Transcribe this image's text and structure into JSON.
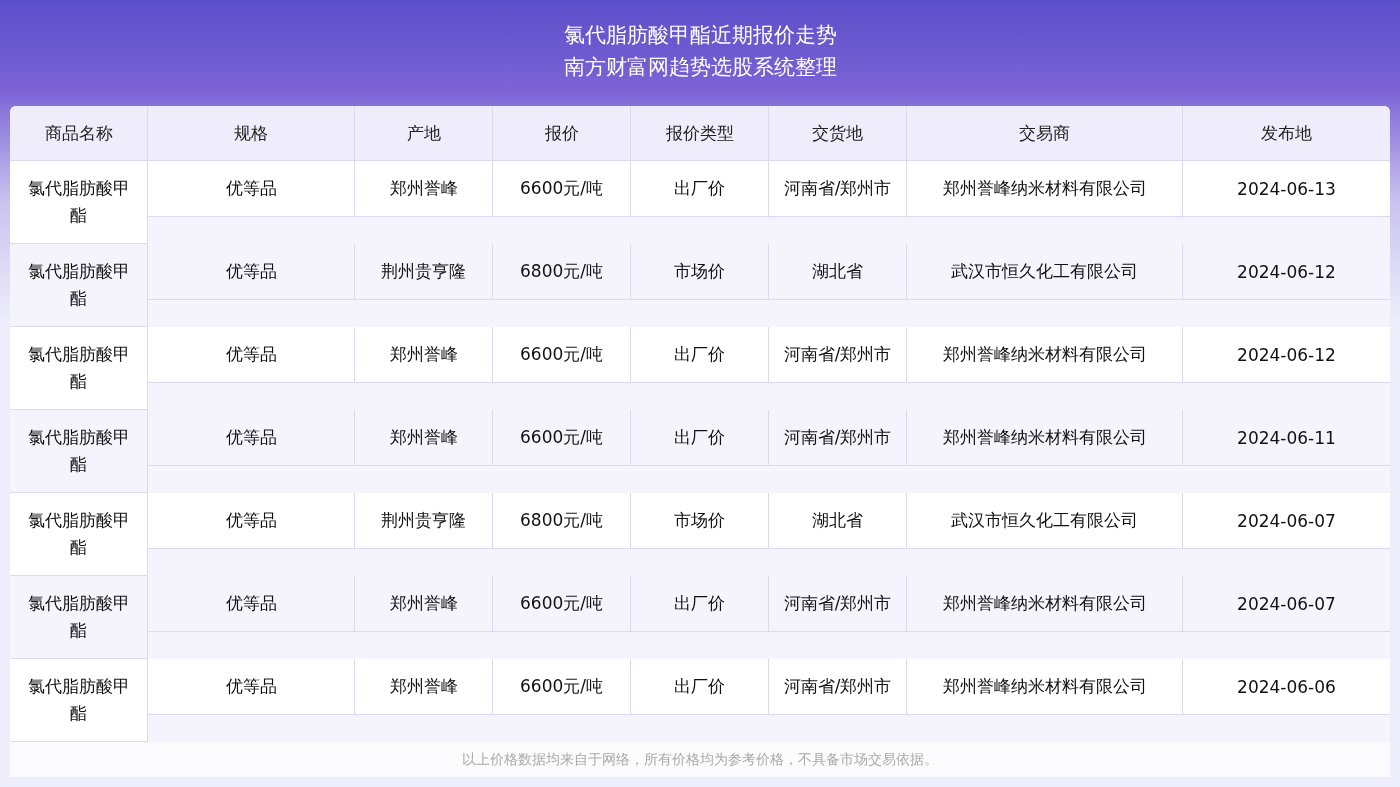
{
  "header": {
    "title": "氯代脂肪酸甲酯近期报价走势",
    "subtitle": "南方财富网趋势选股系统整理"
  },
  "table": {
    "columns": [
      "商品名称",
      "规格",
      "产地",
      "报价",
      "报价类型",
      "交货地",
      "交易商",
      "发布地"
    ],
    "rows": [
      [
        "氯代脂肪酸甲酯",
        "优等品",
        "郑州誉峰",
        "6600元/吨",
        "出厂价",
        "河南省/郑州市",
        "郑州誉峰纳米材料有限公司",
        "2024-06-13"
      ],
      [
        "氯代脂肪酸甲酯",
        "优等品",
        "荆州贵亨隆",
        "6800元/吨",
        "市场价",
        "湖北省",
        "武汉市恒久化工有限公司",
        "2024-06-12"
      ],
      [
        "氯代脂肪酸甲酯",
        "优等品",
        "郑州誉峰",
        "6600元/吨",
        "出厂价",
        "河南省/郑州市",
        "郑州誉峰纳米材料有限公司",
        "2024-06-12"
      ],
      [
        "氯代脂肪酸甲酯",
        "优等品",
        "郑州誉峰",
        "6600元/吨",
        "出厂价",
        "河南省/郑州市",
        "郑州誉峰纳米材料有限公司",
        "2024-06-11"
      ],
      [
        "氯代脂肪酸甲酯",
        "优等品",
        "荆州贵亨隆",
        "6800元/吨",
        "市场价",
        "湖北省",
        "武汉市恒久化工有限公司",
        "2024-06-07"
      ],
      [
        "氯代脂肪酸甲酯",
        "优等品",
        "郑州誉峰",
        "6600元/吨",
        "出厂价",
        "河南省/郑州市",
        "郑州誉峰纳米材料有限公司",
        "2024-06-07"
      ],
      [
        "氯代脂肪酸甲酯",
        "优等品",
        "郑州誉峰",
        "6600元/吨",
        "出厂价",
        "河南省/郑州市",
        "郑州誉峰纳米材料有限公司",
        "2024-06-06"
      ]
    ]
  },
  "footnote": "以上价格数据均来自于网络，所有价格均为参考价格，不具备市场交易依据。"
}
